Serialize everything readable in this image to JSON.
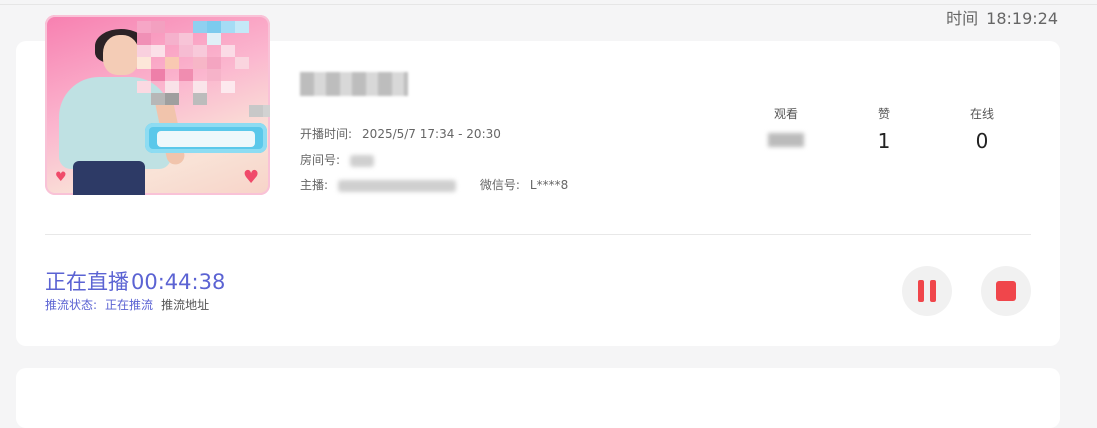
{
  "header": {
    "time_label": "时间",
    "time_value": "18:19:24"
  },
  "room": {
    "start_time_label": "开播时间:",
    "start_time_value": "2025/5/7 17:34 - 20:30",
    "room_no_label": "房间号:",
    "host_label": "主播:",
    "wechat_label": "微信号:",
    "wechat_value": "L****8"
  },
  "stats": [
    {
      "label": "观看",
      "value": ""
    },
    {
      "label": "赞",
      "value": "1"
    },
    {
      "label": "在线",
      "value": "0"
    }
  ],
  "live": {
    "status_text": "正在直播",
    "duration": "00:44:38",
    "push_status_label": "推流状态:",
    "push_status_value": "正在推流",
    "push_address_link": "推流地址"
  },
  "colors": {
    "accent": "#5b63d3",
    "control_red": "#f0464b",
    "card_bg": "#ffffff",
    "page_bg": "#f5f5f6"
  },
  "icons": {
    "pause": "pause-icon",
    "stop": "stop-icon"
  }
}
